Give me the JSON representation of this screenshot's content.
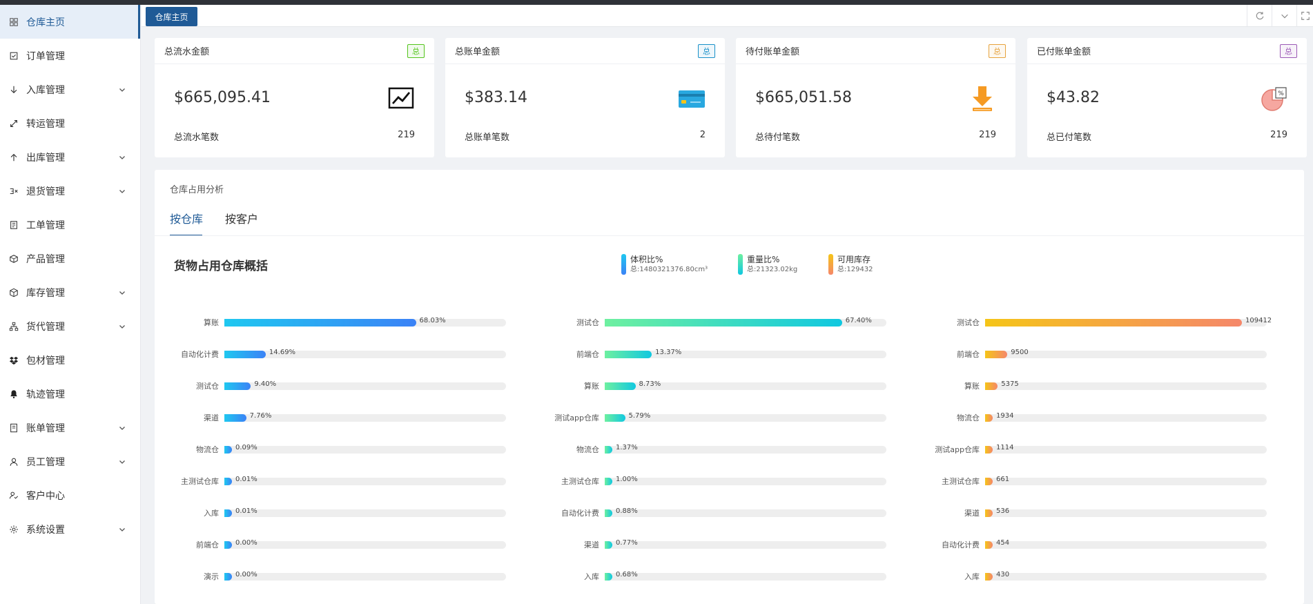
{
  "sidebar": {
    "items": [
      {
        "label": "仓库主页",
        "icon": "grid-icon",
        "active": true,
        "expandable": false
      },
      {
        "label": "订单管理",
        "icon": "order-icon",
        "active": false,
        "expandable": false
      },
      {
        "label": "入库管理",
        "icon": "arrow-down-icon",
        "active": false,
        "expandable": true
      },
      {
        "label": "转运管理",
        "icon": "transfer-icon",
        "active": false,
        "expandable": false
      },
      {
        "label": "出库管理",
        "icon": "arrow-up-icon",
        "active": false,
        "expandable": true
      },
      {
        "label": "退货管理",
        "icon": "return-icon",
        "active": false,
        "expandable": true
      },
      {
        "label": "工单管理",
        "icon": "ticket-icon",
        "active": false,
        "expandable": false
      },
      {
        "label": "产品管理",
        "icon": "product-icon",
        "active": false,
        "expandable": false
      },
      {
        "label": "库存管理",
        "icon": "box-icon",
        "active": false,
        "expandable": true
      },
      {
        "label": "货代管理",
        "icon": "network-icon",
        "active": false,
        "expandable": true
      },
      {
        "label": "包材管理",
        "icon": "dropbox-icon",
        "active": false,
        "expandable": false
      },
      {
        "label": "轨迹管理",
        "icon": "bell-icon",
        "active": false,
        "expandable": false
      },
      {
        "label": "账单管理",
        "icon": "bill-icon",
        "active": false,
        "expandable": true
      },
      {
        "label": "员工管理",
        "icon": "user-icon",
        "active": false,
        "expandable": true
      },
      {
        "label": "客户中心",
        "icon": "customer-icon",
        "active": false,
        "expandable": false
      },
      {
        "label": "系统设置",
        "icon": "gear-icon",
        "active": false,
        "expandable": true
      }
    ]
  },
  "tabbar": {
    "active_tab": "仓库主页"
  },
  "cards": [
    {
      "title": "总流水金额",
      "badge": "总",
      "badge_color": "#52c41a",
      "amount": "$665,095.41",
      "icon": "trend-chart-icon",
      "count_label": "总流水笔数",
      "count": "219"
    },
    {
      "title": "总账单金额",
      "badge": "总",
      "badge_color": "#1890c8",
      "amount": "$383.14",
      "icon": "credit-card-icon",
      "count_label": "总账单笔数",
      "count": "2"
    },
    {
      "title": "待付账单金额",
      "badge": "总",
      "badge_color": "#e6a23c",
      "amount": "$665,051.58",
      "icon": "download-icon",
      "count_label": "总待付笔数",
      "count": "219"
    },
    {
      "title": "已付账单金额",
      "badge": "总",
      "badge_color": "#9b59b6",
      "amount": "$43.82",
      "icon": "pie-percent-icon",
      "count_label": "总已付笔数",
      "count": "219"
    }
  ],
  "analysis": {
    "panel_title": "仓库占用分析",
    "tabs": [
      "按仓库",
      "按客户"
    ],
    "active_tab": 0,
    "chart_title": "货物占用仓库概括",
    "legend": [
      {
        "name": "体积比%",
        "total": "总:1480321376.80cm³",
        "color_from": "#1fc8f0",
        "color_to": "#3b82f6"
      },
      {
        "name": "重量比%",
        "total": "总:21323.02kg",
        "color_from": "#6ef0a0",
        "color_to": "#10c8e0"
      },
      {
        "name": "可用库存",
        "total": "总:129432",
        "color_from": "#f5c518",
        "color_to": "#f5876a"
      }
    ]
  },
  "chart_data": [
    {
      "type": "bar",
      "series_name": "体积比%",
      "unit": "%",
      "max": 100,
      "categories": [
        "算账",
        "自动化计费",
        "测试仓",
        "渠道",
        "物流仓",
        "主测试仓库",
        "入库",
        "前端仓",
        "演示"
      ],
      "values": [
        68.03,
        14.69,
        9.4,
        7.76,
        0.09,
        0.01,
        0.01,
        0.0,
        0.0
      ],
      "labels": [
        "68.03%",
        "14.69%",
        "9.40%",
        "7.76%",
        "0.09%",
        "0.01%",
        "0.01%",
        "0.00%",
        "0.00%"
      ],
      "color_from": "#1fc8f0",
      "color_to": "#3b82f6"
    },
    {
      "type": "bar",
      "series_name": "重量比%",
      "unit": "%",
      "max": 80,
      "categories": [
        "测试仓",
        "前端仓",
        "算账",
        "测试app仓库",
        "物流仓",
        "主测试仓库",
        "自动化计费",
        "渠道",
        "入库"
      ],
      "values": [
        67.4,
        13.37,
        8.73,
        5.79,
        1.37,
        1.0,
        0.88,
        0.77,
        0.68
      ],
      "labels": [
        "67.40%",
        "13.37%",
        "8.73%",
        "5.79%",
        "1.37%",
        "1.00%",
        "0.88%",
        "0.77%",
        "0.68%"
      ],
      "color_from": "#6ef0a0",
      "color_to": "#10c8e0"
    },
    {
      "type": "bar",
      "series_name": "可用库存",
      "unit": "",
      "max": 120000,
      "categories": [
        "测试仓",
        "前端仓",
        "算账",
        "物流仓",
        "测试app仓库",
        "主测试仓库",
        "渠道",
        "自动化计费",
        "入库"
      ],
      "values": [
        109412,
        9500,
        5375,
        1934,
        1114,
        661,
        536,
        454,
        430
      ],
      "labels": [
        "109412",
        "9500",
        "5375",
        "1934",
        "1114",
        "661",
        "536",
        "454",
        "430"
      ],
      "color_from": "#f5c518",
      "color_to": "#f5876a"
    }
  ]
}
